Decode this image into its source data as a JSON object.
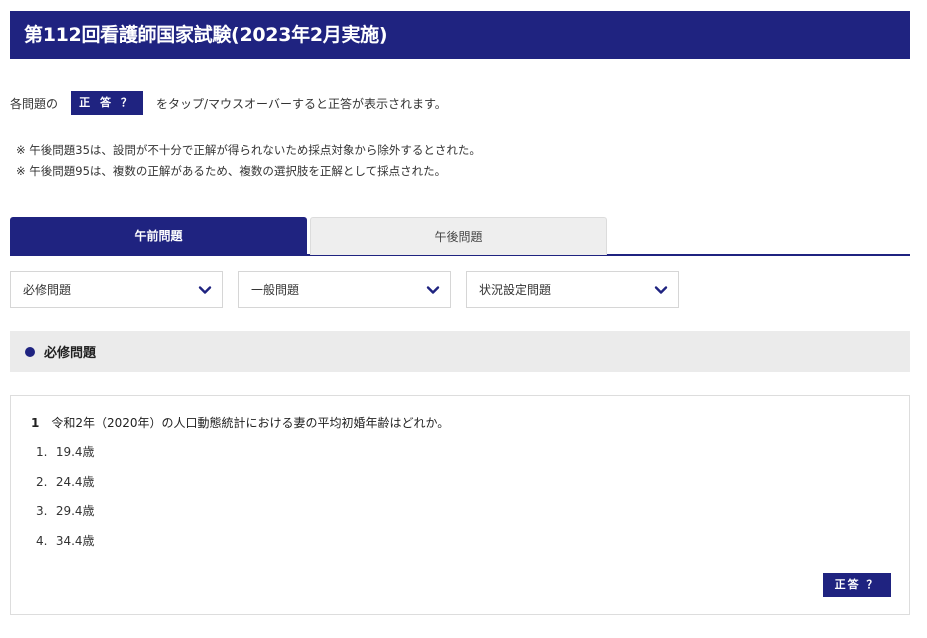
{
  "header": {
    "title": "第112回看護師国家試験(2023年2月実施)"
  },
  "intro": {
    "prefix": "各問題の",
    "button_label": "正 答 ？",
    "suffix": "をタップ/マウスオーバーすると正答が表示されます。"
  },
  "notes": [
    "※ 午後問題35は、設問が不十分で正解が得られないため採点対象から除外するとされた。",
    "※ 午後問題95は、複数の正解があるため、複数の選択肢を正解として採点された。"
  ],
  "tabs": [
    {
      "label": "午前問題",
      "active": true
    },
    {
      "label": "午後問題",
      "active": false
    }
  ],
  "selects": [
    {
      "value": "必修問題"
    },
    {
      "value": "一般問題"
    },
    {
      "value": "状況設定問題"
    }
  ],
  "section": {
    "title": "必修問題"
  },
  "question": {
    "number": "1",
    "text": "令和2年（2020年）の人口動態統計における妻の平均初婚年齢はどれか。",
    "choices": [
      {
        "num": "1.",
        "text": "19.4歳"
      },
      {
        "num": "2.",
        "text": "24.4歳"
      },
      {
        "num": "3.",
        "text": "29.4歳"
      },
      {
        "num": "4.",
        "text": "34.4歳"
      }
    ],
    "answer_button": "正答 ？"
  },
  "colors": {
    "brand": "#1f2380",
    "tab_inactive": "#eeeeee",
    "section_bg": "#ebebeb"
  }
}
